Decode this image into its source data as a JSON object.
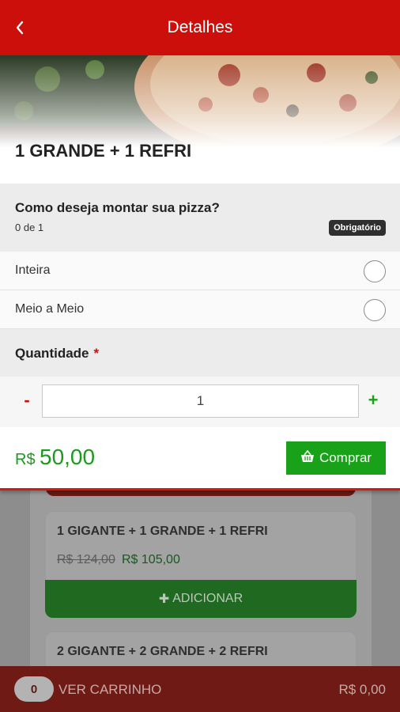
{
  "header": {
    "title": "Detalhes",
    "back_icon": "chevron-left-icon"
  },
  "product": {
    "name": "1 GRANDE + 1 REFRI"
  },
  "option_group": {
    "question": "Como deseja montar sua pizza?",
    "count": "0 de 1",
    "badge": "Obrigatório",
    "options": [
      {
        "label": "Inteira",
        "selected": false
      },
      {
        "label": "Meio a Meio",
        "selected": false
      }
    ]
  },
  "quantity": {
    "label": "Quantidade",
    "required_mark": "*",
    "minus": "-",
    "plus": "+",
    "value": "1"
  },
  "total": {
    "currency": "R$",
    "amount": "50,00",
    "buy_label": "Comprar",
    "buy_icon": "basket-icon"
  },
  "background_list": [
    {
      "title": "1 GIGANTE + 1 GRANDE + 1 REFRI",
      "old_price": "R$ 124,00",
      "new_price": "R$ 105,00",
      "add_label": "ADICIONAR",
      "add_icon": "plus-icon"
    },
    {
      "title": "2 GIGANTE + 2 GRANDE + 2 REFRI"
    }
  ],
  "cart": {
    "count": "0",
    "label": "VER CARRINHO",
    "total": "R$ 0,00"
  },
  "colors": {
    "brand_red": "#cc0f0a",
    "accent_green": "#19a119",
    "badge_dark": "#2f2f2f"
  }
}
